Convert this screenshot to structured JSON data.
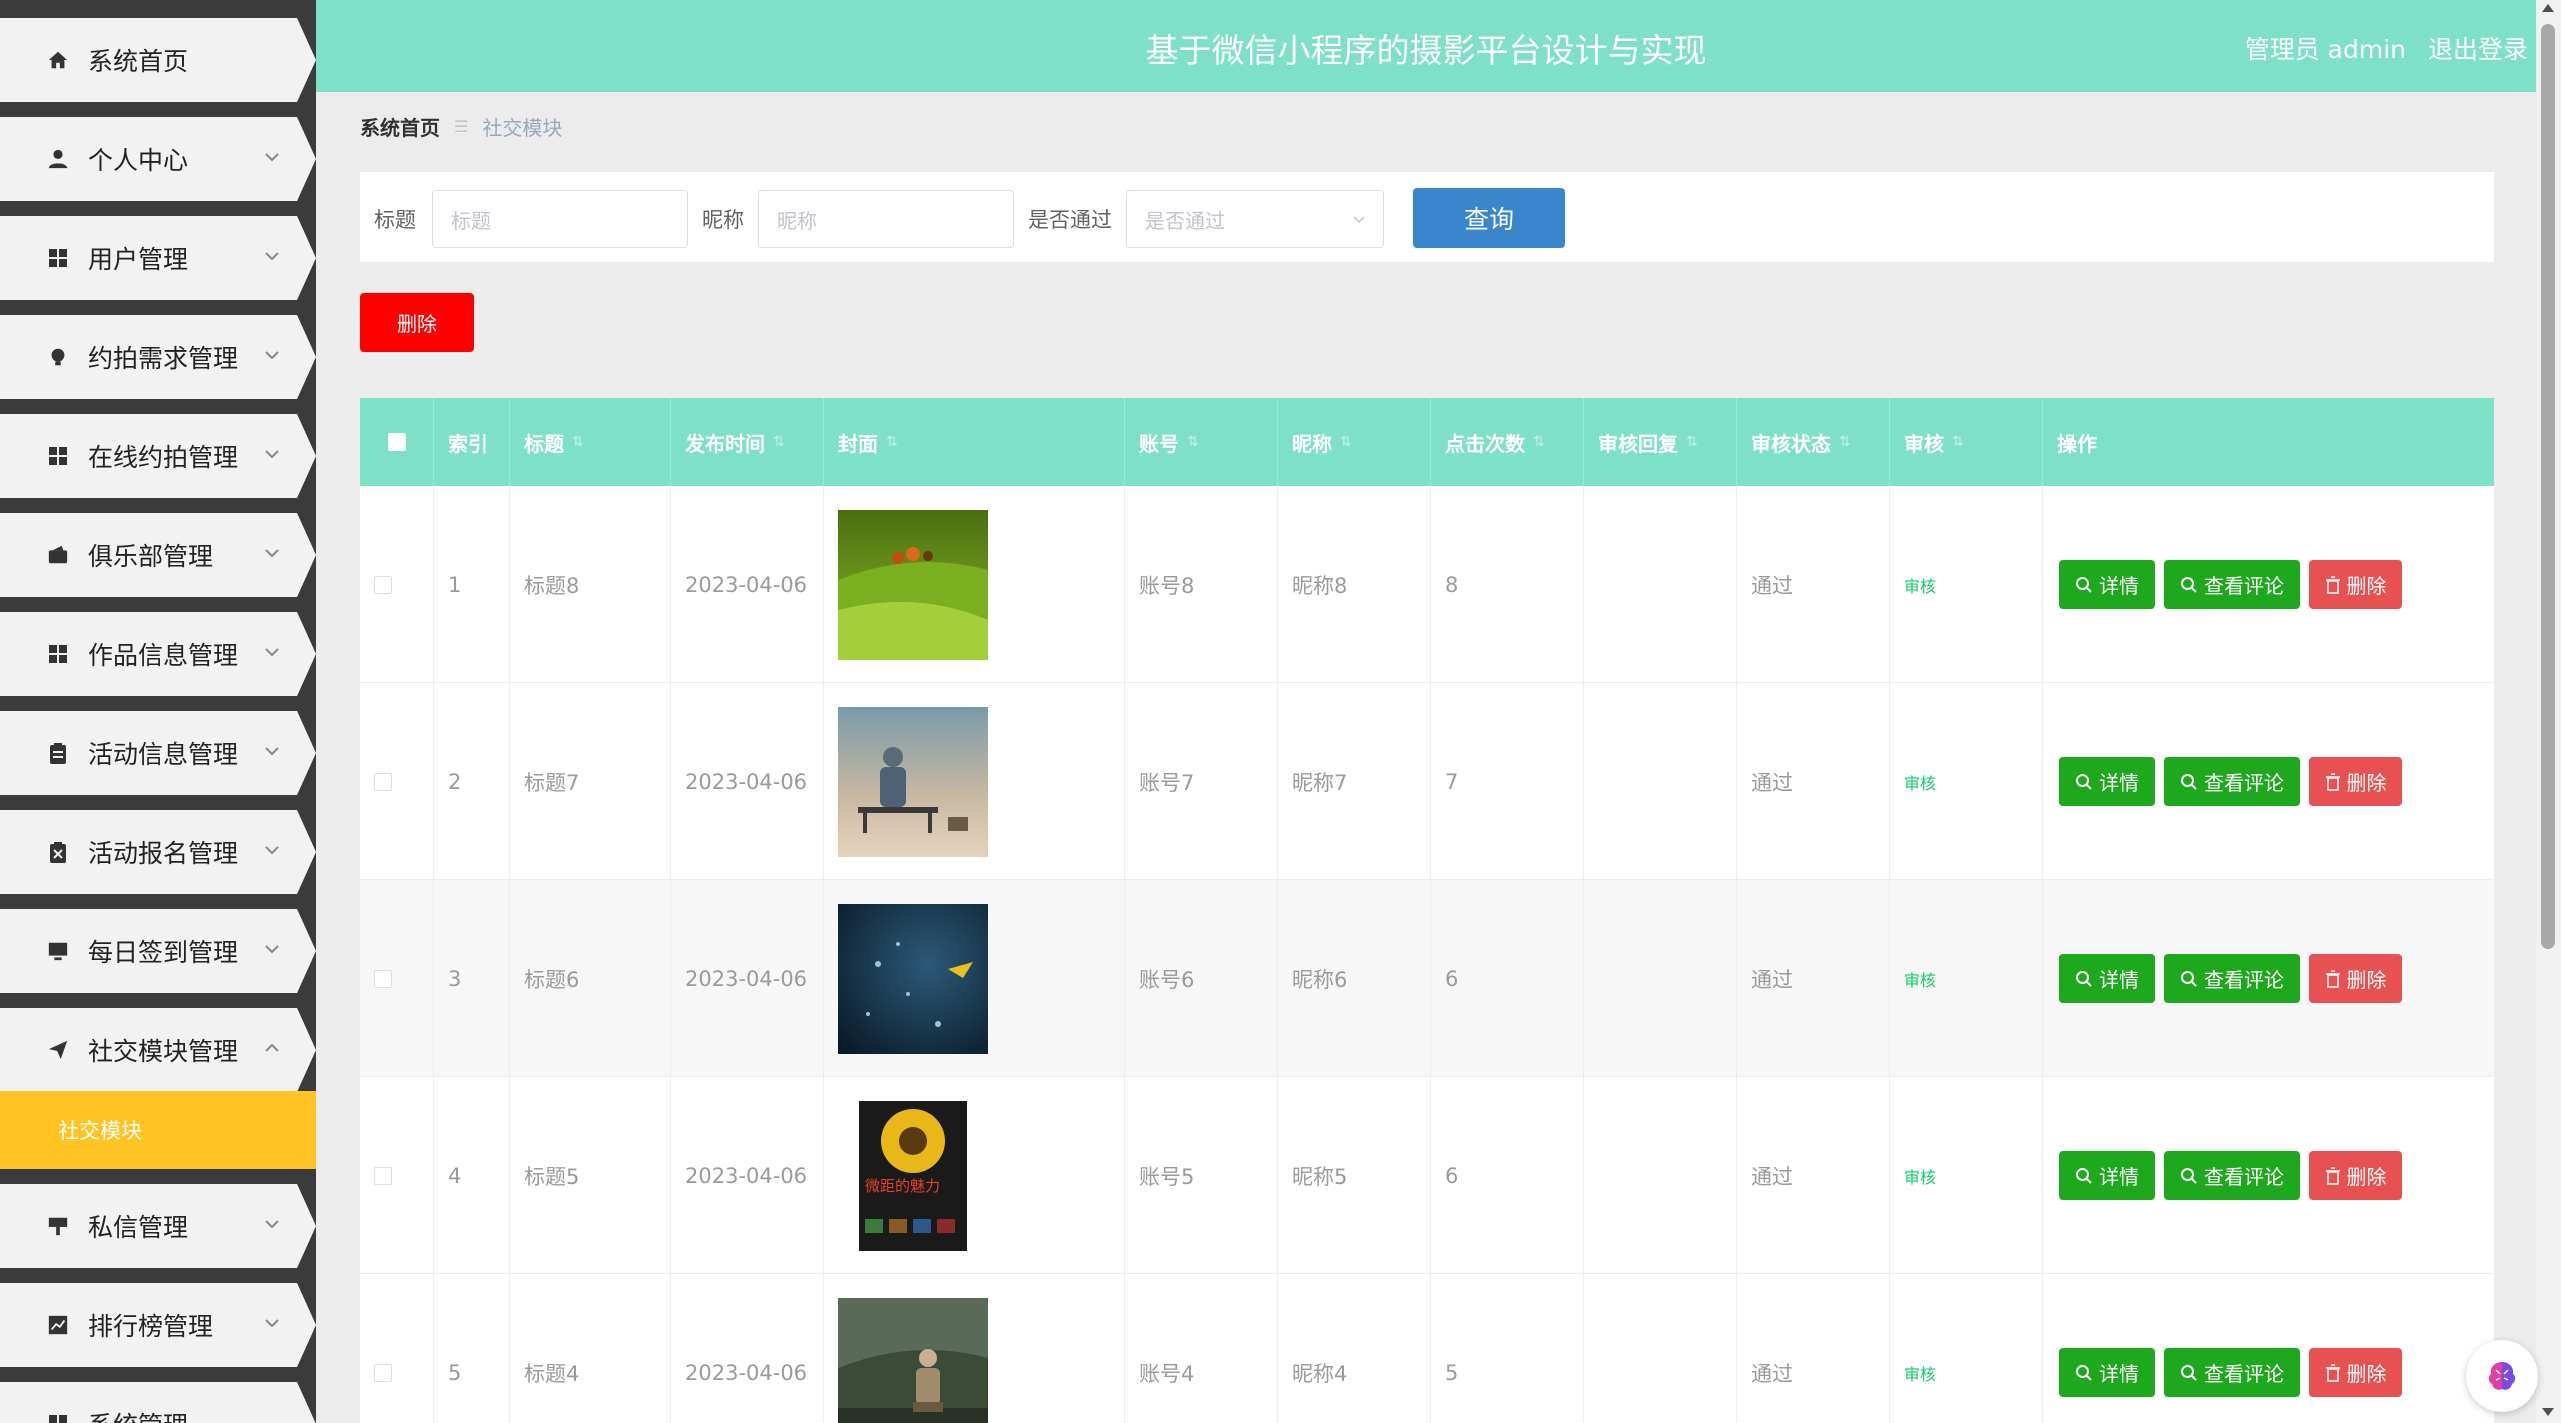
{
  "header": {
    "title": "基于微信小程序的摄影平台设计与实现",
    "user": "管理员 admin",
    "logout": "退出登录"
  },
  "sidebar": {
    "items": [
      {
        "label": "系统首页",
        "icon": "home-icon"
      },
      {
        "label": "个人中心",
        "icon": "user-icon"
      },
      {
        "label": "用户管理",
        "icon": "grid-icon"
      },
      {
        "label": "约拍需求管理",
        "icon": "bulb-icon"
      },
      {
        "label": "在线约拍管理",
        "icon": "grid-icon"
      },
      {
        "label": "俱乐部管理",
        "icon": "wallet-icon"
      },
      {
        "label": "作品信息管理",
        "icon": "grid-icon"
      },
      {
        "label": "活动信息管理",
        "icon": "clipboard-icon"
      },
      {
        "label": "活动报名管理",
        "icon": "clipboard-x-icon"
      },
      {
        "label": "每日签到管理",
        "icon": "monitor-icon"
      },
      {
        "label": "社交模块管理",
        "icon": "send-icon"
      },
      {
        "label": "私信管理",
        "icon": "sign-icon"
      },
      {
        "label": "排行榜管理",
        "icon": "chart-icon"
      },
      {
        "label": "系统管理",
        "icon": "grid-icon"
      }
    ],
    "submenu": {
      "label": "社交模块"
    },
    "active_color": "#ffc424"
  },
  "breadcrumb": {
    "home": "系统首页",
    "current": "社交模块"
  },
  "search": {
    "title_label": "标题",
    "title_placeholder": "标题",
    "nick_label": "昵称",
    "nick_placeholder": "昵称",
    "pass_label": "是否通过",
    "pass_placeholder": "是否通过",
    "query_button": "查询"
  },
  "actions": {
    "delete_button": "删除"
  },
  "table": {
    "columns": [
      "索引",
      "标题",
      "发布时间",
      "封面",
      "账号",
      "昵称",
      "点击次数",
      "审核回复",
      "审核状态",
      "审核",
      "操作"
    ],
    "sort_glyph": "⇅",
    "rows": [
      {
        "index": "1",
        "title": "标题8",
        "time": "2023-04-06",
        "account": "账号8",
        "nick": "昵称8",
        "clicks": "8",
        "reply": "",
        "status": "通过",
        "audit": "审核"
      },
      {
        "index": "2",
        "title": "标题7",
        "time": "2023-04-06",
        "account": "账号7",
        "nick": "昵称7",
        "clicks": "7",
        "reply": "",
        "status": "通过",
        "audit": "审核"
      },
      {
        "index": "3",
        "title": "标题6",
        "time": "2023-04-06",
        "account": "账号6",
        "nick": "昵称6",
        "clicks": "6",
        "reply": "",
        "status": "通过",
        "audit": "审核"
      },
      {
        "index": "4",
        "title": "标题5",
        "time": "2023-04-06",
        "account": "账号5",
        "nick": "昵称5",
        "clicks": "6",
        "reply": "",
        "status": "通过",
        "audit": "审核"
      },
      {
        "index": "5",
        "title": "标题4",
        "time": "2023-04-06",
        "account": "账号4",
        "nick": "昵称4",
        "clicks": "5",
        "reply": "",
        "status": "通过",
        "audit": "审核"
      }
    ],
    "op_detail": "详情",
    "op_comment": "查看评论",
    "op_delete": "删除",
    "cover_4_text": "微距的魅力"
  },
  "colors": {
    "header": "#7fe0c8",
    "query": "#3a86cc",
    "danger": "#ff0000",
    "success": "#1ea81e",
    "op_delete": "#e85151"
  }
}
